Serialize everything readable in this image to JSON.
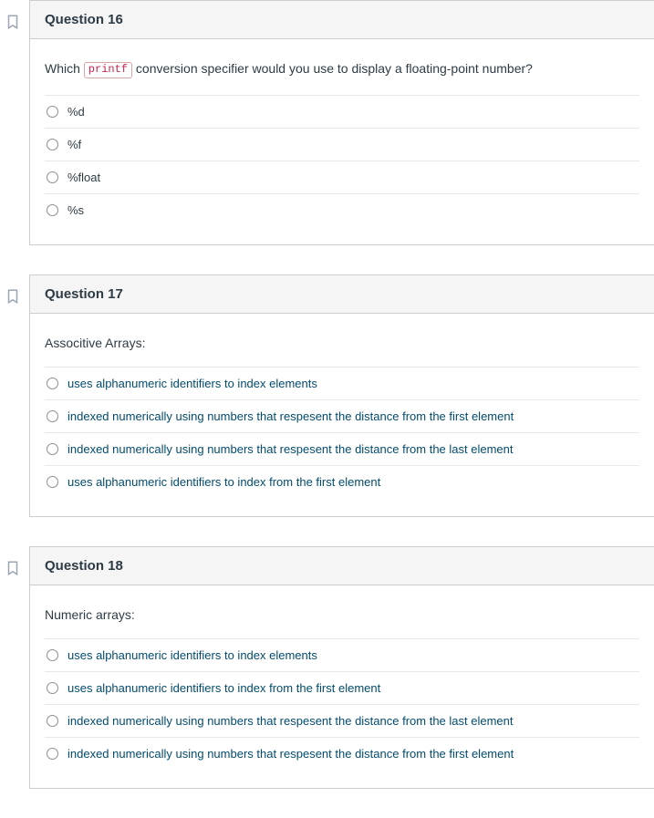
{
  "questions": [
    {
      "id": "q16",
      "title": "Question 16",
      "prompt_before": "Which ",
      "prompt_code": "printf",
      "prompt_after": " conversion specifier would you use to display a floating-point number?",
      "answer_style": "plain",
      "answers": [
        "%d",
        "%f",
        "%float",
        "%s"
      ]
    },
    {
      "id": "q17",
      "title": "Question 17",
      "prompt": "Associtive Arrays:",
      "answer_style": "link",
      "answers": [
        "uses alphanumeric identifiers to index elements",
        "indexed numerically using numbers that respesent the distance from the first element",
        "indexed numerically using numbers that respesent the distance from the last element",
        "uses alphanumeric identifiers to index from the first element"
      ]
    },
    {
      "id": "q18",
      "title": "Question 18",
      "prompt": "Numeric arrays:",
      "answer_style": "link",
      "answers": [
        "uses alphanumeric identifiers to index elements",
        "uses alphanumeric identifiers to index from the first element",
        "indexed numerically using numbers that respesent the distance from the last element",
        "indexed numerically using numbers that respesent the distance from the first element"
      ]
    }
  ]
}
